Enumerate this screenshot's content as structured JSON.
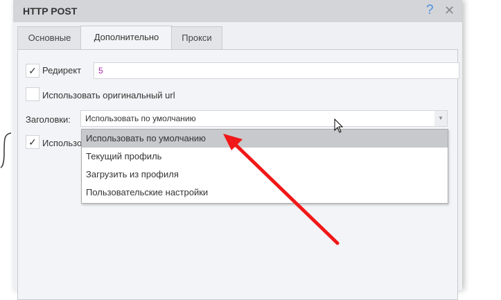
{
  "dialog": {
    "title": "HTTP POST",
    "help_icon": "?",
    "close_icon": "✕"
  },
  "tabs": [
    {
      "label": "Основные"
    },
    {
      "label": "Дополнительно",
      "active": true
    },
    {
      "label": "Прокси"
    }
  ],
  "redirect": {
    "checked": true,
    "label": "Редирект",
    "value": "5"
  },
  "original_url": {
    "checked": false,
    "label": "Использовать оригинальный url"
  },
  "headers": {
    "label": "Заголовки:",
    "value": "Использовать по умолчанию"
  },
  "hidden_option": {
    "checked": true,
    "label": "Использо"
  },
  "dropdown": {
    "options": [
      "Использовать по умолчанию",
      "Текущий профиль",
      "Загрузить из профиля",
      "Пользовательские настройки"
    ],
    "selected_index": 0
  },
  "colors": {
    "arrow": "#f01818",
    "value_text": "#a020a0"
  }
}
